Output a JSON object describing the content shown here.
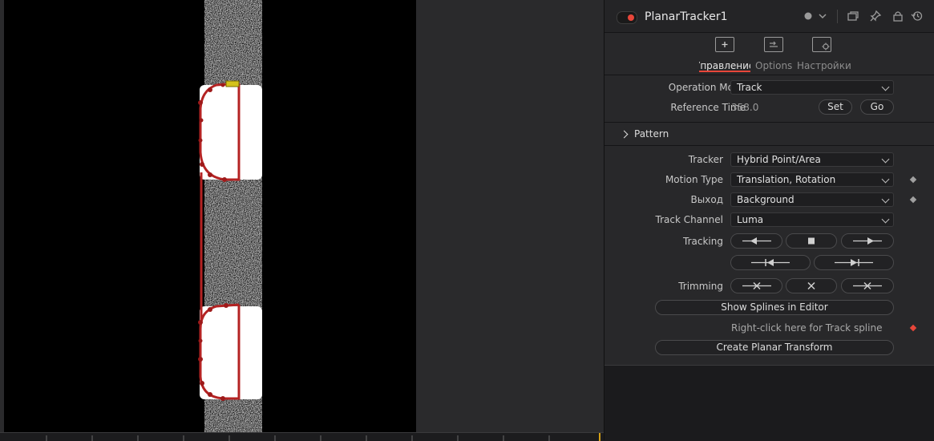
{
  "node": {
    "title": "PlanarTracker1",
    "enabled": true
  },
  "header_icons": [
    "color-dot-icon",
    "chevron-down-icon",
    "versions-icon",
    "pin-icon",
    "lock-icon",
    "reset-icon"
  ],
  "tabs": [
    {
      "label": "Управление",
      "icon": "controls-tab-icon",
      "active": true
    },
    {
      "label": "Options",
      "icon": "options-tab-icon",
      "active": false
    },
    {
      "label": "Настройки",
      "icon": "settings-tab-icon",
      "active": false
    }
  ],
  "operation_mode": {
    "label": "Operation Mode",
    "value": "Track"
  },
  "reference_time": {
    "label": "Reference Time",
    "value": "358.0",
    "set_label": "Set",
    "go_label": "Go"
  },
  "pattern": {
    "label": "Pattern",
    "expanded": false
  },
  "tracker": {
    "label": "Tracker",
    "value": "Hybrid Point/Area"
  },
  "motion_type": {
    "label": "Motion Type",
    "value": "Translation, Rotation"
  },
  "output": {
    "label": "Выход",
    "value": "Background"
  },
  "track_channel": {
    "label": "Track Channel",
    "value": "Luma"
  },
  "tracking": {
    "label": "Tracking",
    "buttons": [
      "track-backward-icon",
      "stop-icon",
      "track-forward-icon",
      "track-backward-from-end-icon",
      "track-forward-from-start-icon"
    ]
  },
  "trimming": {
    "label": "Trimming",
    "buttons": [
      "trim-before-icon",
      "delete-track-icon",
      "trim-after-icon"
    ]
  },
  "show_splines_label": "Show Splines in Editor",
  "track_spline_note": "Right-click here for Track spline",
  "create_transform_label": "Create Planar Transform",
  "colors": {
    "accent": "#e8463a",
    "spline": "#b42323",
    "keyframe": "#e8463a"
  }
}
